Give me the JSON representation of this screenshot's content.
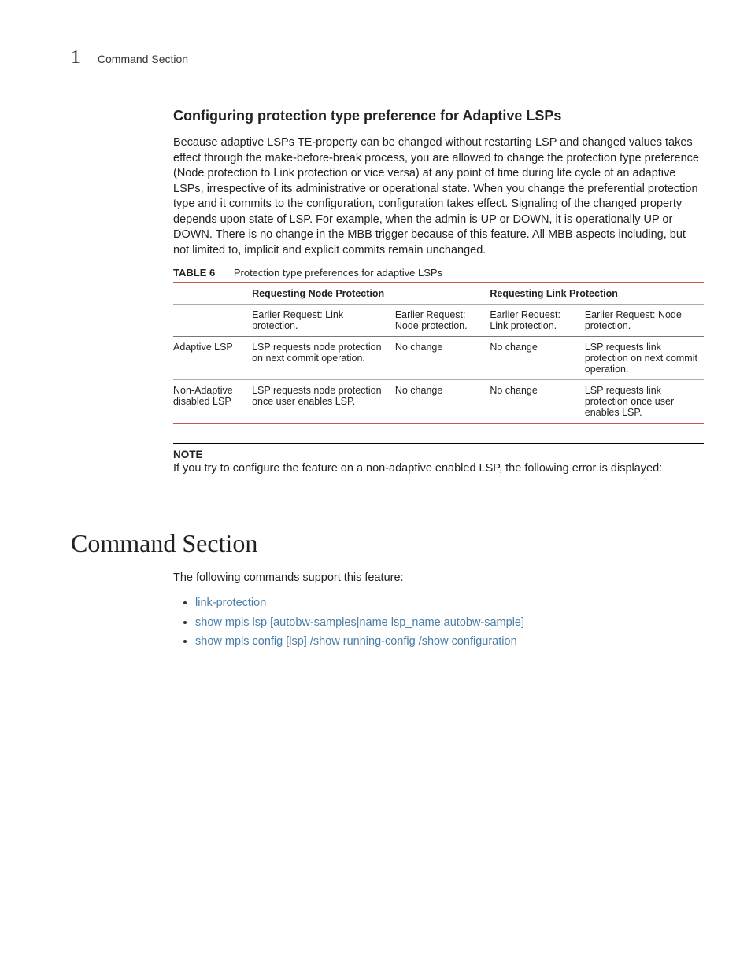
{
  "header": {
    "chapter_number": "1",
    "running_title": "Command Section"
  },
  "section1": {
    "heading": "Configuring protection type preference for Adaptive LSPs",
    "paragraph": "Because adaptive LSPs TE-property can be changed without restarting LSP and changed values takes effect through the make-before-break process, you are allowed to change the protection type preference (Node protection to Link protection or vice versa) at any point of time during life cycle of an adaptive LSPs, irrespective of its administrative or operational state. When you change the preferential protection type and it commits to the configuration, configuration takes effect. Signaling of the changed property depends upon state of LSP. For example, when the admin is UP or DOWN, it is operationally UP or DOWN. There is no change in the MBB trigger because of this feature. All MBB aspects including, but not limited to, implicit and explicit commits remain unchanged."
  },
  "table": {
    "label": "TABLE 6",
    "title": "Protection type preferences for adaptive LSPs",
    "top_headers": {
      "blank": "",
      "node": "Requesting Node Protection",
      "link": "Requesting Link Protection"
    },
    "sub_headers": {
      "c1": "Earlier Request: Link protection.",
      "c2": "Earlier Request: Node protection.",
      "c3": "Earlier Request: Link protection.",
      "c4": "Earlier Request: Node protection."
    },
    "rows": [
      {
        "label": "Adaptive LSP",
        "c1": "LSP requests node protection on next commit operation.",
        "c2": "No change",
        "c3": "No change",
        "c4": "LSP requests link protection on next commit operation."
      },
      {
        "label": "Non-Adaptive disabled LSP",
        "c1": "LSP requests node protection once user enables LSP.",
        "c2": "No change",
        "c3": "No change",
        "c4": "LSP requests link protection once user enables LSP."
      }
    ]
  },
  "note": {
    "label": "NOTE",
    "text": "If you try to configure the feature on a non-adaptive enabled LSP, the following error is displayed:"
  },
  "section2": {
    "heading": "Command Section",
    "intro": "The following commands support this feature:",
    "items": [
      "link-protection",
      "show mpls lsp [autobw-samples|name lsp_name autobw-sample]",
      "show mpls config [lsp] /show running-config /show configuration"
    ]
  }
}
